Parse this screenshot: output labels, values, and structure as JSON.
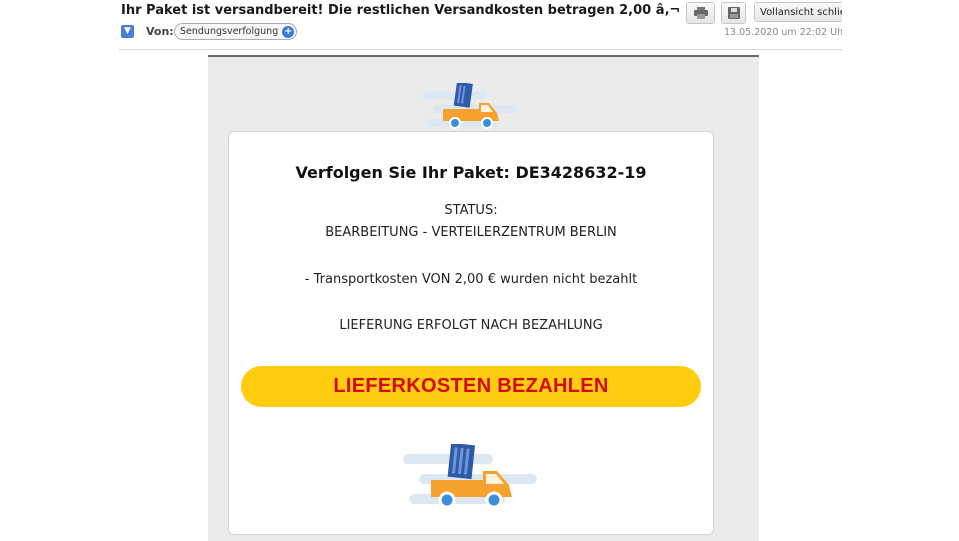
{
  "header": {
    "subject": "Ihr Paket ist versandbereit! Die restlichen Versandkosten betragen 2,00 â‚¬",
    "from_label": "Von:",
    "sender": "Sendungsverfolgung",
    "timestamp": "13.05.2020 um 22:02 Uhr",
    "close_view_label": "Vollansicht schließen",
    "icons": [
      "expand-icon",
      "add-contact-icon",
      "print-icon",
      "save-icon"
    ]
  },
  "email": {
    "tracking_title": "Verfolgen Sie Ihr Paket: DE3428632-19",
    "status_label": "STATUS:",
    "status_value": "BEARBEITUNG - VERTEILERZENTRUM BERLIN",
    "cost_note": "- Transportkosten VON 2,00 € wurden nicht bezahlt",
    "delivery_note": "LIEFERUNG ERFOLGT NACH BEZAHLUNG",
    "pay_button": "LIEFERKOSTEN BEZAHLEN",
    "colors": {
      "button_bg": "#ffcc10",
      "button_text": "#d40a17",
      "truck_orange": "#f7a22e",
      "box_blue": "#2e5aa8",
      "wheel_blue": "#3b8fd9"
    }
  }
}
